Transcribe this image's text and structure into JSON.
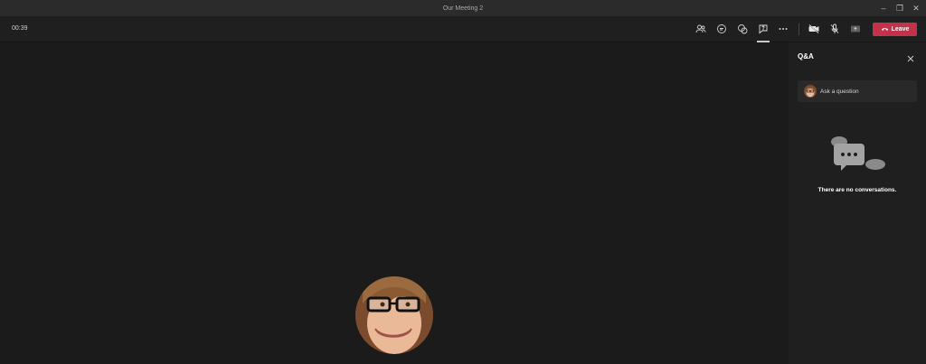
{
  "window": {
    "title": "Our Meeting 2",
    "controls": {
      "minimize": "–",
      "restore": "❐",
      "close": "✕"
    }
  },
  "toolbar": {
    "timer": "00:39",
    "leave_label": "Leave",
    "icons": [
      "participants-icon",
      "chat-icon",
      "reactions-icon",
      "qa-icon",
      "more-icon",
      "camera-off-icon",
      "mic-off-icon",
      "share-icon"
    ]
  },
  "qa_panel": {
    "title": "Q&A",
    "ask_placeholder": "Ask a question",
    "empty_message": "There are no conversations."
  },
  "colors": {
    "leave": "#c4314b",
    "background": "#1b1b1b",
    "panel": "#1f1f1f"
  }
}
